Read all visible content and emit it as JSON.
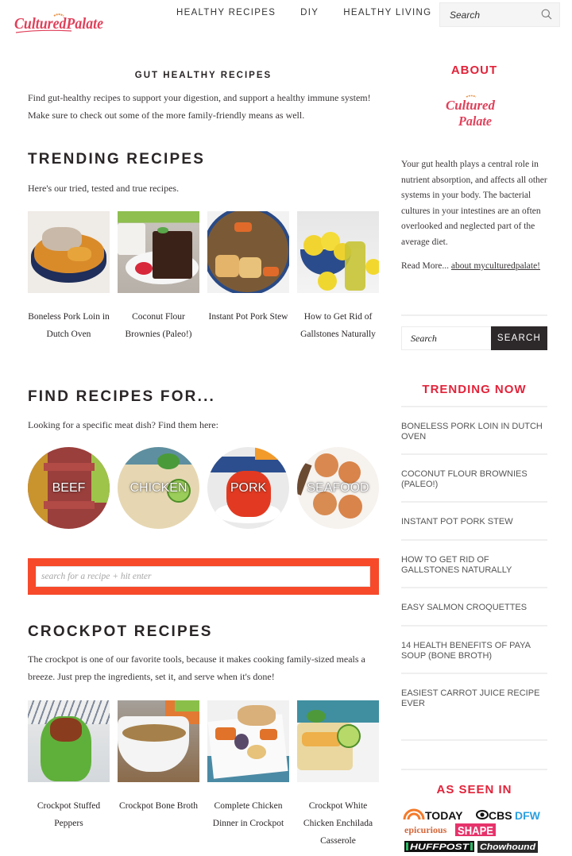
{
  "header": {
    "logo_alt": "Cultured Palate",
    "nav": [
      {
        "label": "HEALTHY RECIPES"
      },
      {
        "label": "DIY"
      },
      {
        "label": "HEALTHY LIVING"
      }
    ],
    "search_placeholder": "Search",
    "search_icon": "search-icon"
  },
  "main": {
    "page_heading": "GUT HEALTHY RECIPES",
    "intro": "Find gut-healthy recipes to support your digestion, and support a healthy immune system! Make sure to check out some of the more family-friendly means as well.",
    "trending": {
      "title": "TRENDING RECIPES",
      "subtitle": "Here's our tried, tested and true recipes.",
      "recipes": [
        {
          "title": "Boneless Pork Loin in Dutch Oven"
        },
        {
          "title": "Coconut Flour Brownies (Paleo!)"
        },
        {
          "title": "Instant Pot Pork Stew"
        },
        {
          "title": "How to Get Rid of Gallstones Naturally"
        }
      ]
    },
    "find": {
      "title": "FIND RECIPES FOR...",
      "subtitle": "Looking for a specific meat dish? Find them here:",
      "categories": [
        {
          "label": "BEEF"
        },
        {
          "label": "CHICKEN"
        },
        {
          "label": "PORK"
        },
        {
          "label": "SEAFOOD"
        }
      ]
    },
    "recipe_search": {
      "placeholder": "search for a recipe + hit enter",
      "border_color": "#f64a2b"
    },
    "crockpot": {
      "title": "CROCKPOT RECIPES",
      "subtitle": "The crockpot is one of our favorite tools, because it makes cooking family-sized meals a breeze. Just prep the ingredients, set it, and serve when it's done!",
      "recipes": [
        {
          "title": "Crockpot Stuffed Peppers"
        },
        {
          "title": "Crockpot Bone Broth"
        },
        {
          "title": "Complete Chicken Dinner in Crockpot"
        },
        {
          "title": "Crockpot White Chicken Enchilada Casserole"
        }
      ]
    }
  },
  "sidebar": {
    "about_title": "ABOUT",
    "about_text": "Your gut health plays a central role in nutrient absorption, and affects all other systems in your body. The bacterial cultures in your intestines are an often overlooked and neglected part of the average diet.",
    "read_more_prefix": "Read More...",
    "read_more_link": "about myculturedpalate!",
    "search_placeholder": "Search",
    "search_button": "SEARCH",
    "trending_title": "TRENDING NOW",
    "trending": [
      {
        "label": "BONELESS PORK LOIN IN DUTCH OVEN"
      },
      {
        "label": "COCONUT FLOUR BROWNIES (PALEO!)"
      },
      {
        "label": "INSTANT POT PORK STEW"
      },
      {
        "label": "HOW TO GET RID OF GALLSTONES NATURALLY"
      },
      {
        "label": "EASY SALMON CROQUETTES"
      },
      {
        "label": "14 HEALTH BENEFITS OF PAYA SOUP (BONE BROTH)"
      },
      {
        "label": "EASIEST CARROT JUICE RECIPE EVER"
      }
    ],
    "as_seen_title": "AS SEEN IN",
    "press": [
      {
        "name": "TODAY"
      },
      {
        "name": "CBS"
      },
      {
        "name": "DFW"
      },
      {
        "name": "epicurious"
      },
      {
        "name": "SHAPE"
      },
      {
        "name": "HUFFPOST"
      },
      {
        "name": "Chowhound"
      }
    ]
  },
  "colors": {
    "brand_red": "#e2233a",
    "accent_orange": "#f64a2b",
    "dark": "#2d2829"
  }
}
